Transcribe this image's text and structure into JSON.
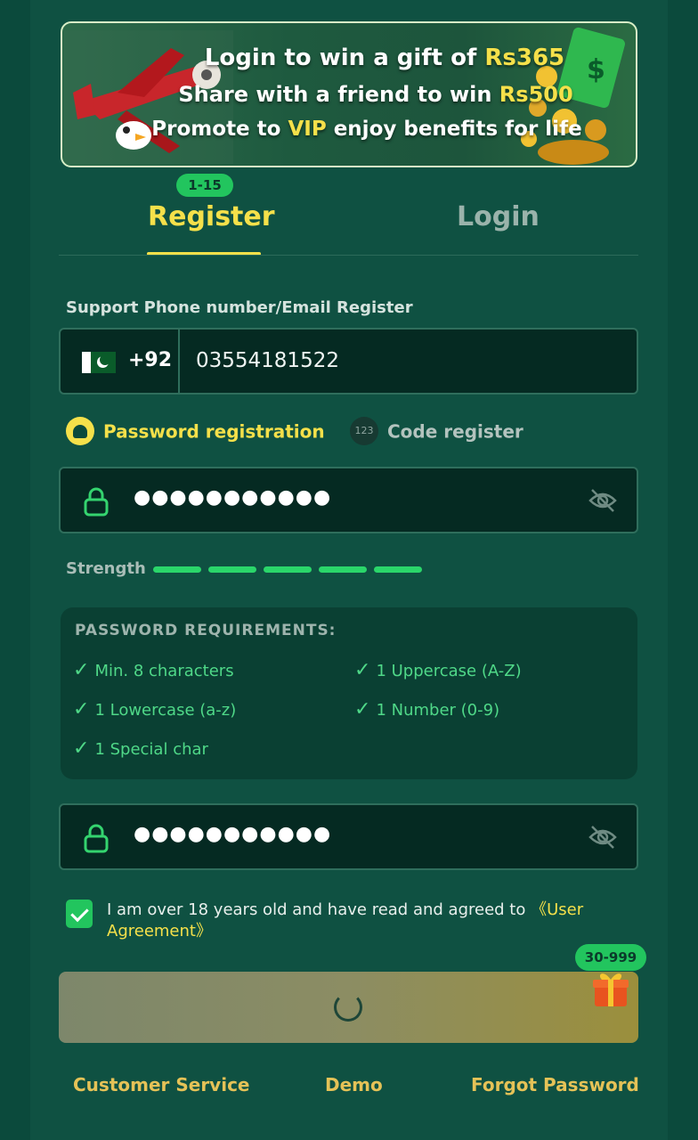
{
  "banner": {
    "line1_pre": "Login to win a gift of ",
    "line1_hl": "Rs365",
    "line2_pre": "Share with a friend to win ",
    "line2_hl": "Rs500",
    "line3_pre": "Promote to ",
    "line3_hl": "VIP",
    "line3_post": " enjoy benefits for life"
  },
  "tabs": {
    "register_badge": "1-15",
    "register": "Register",
    "login": "Login"
  },
  "phone": {
    "label": "Support Phone number/Email Register",
    "country_code": "+92",
    "value": "03554181522"
  },
  "modes": {
    "password": "Password registration",
    "code_icon": "123",
    "code": "Code register"
  },
  "password": {
    "masked": "●●●●●●●●●●●",
    "confirm_masked": "●●●●●●●●●●●"
  },
  "strength": {
    "label": "Strength",
    "level": 5,
    "max": 5
  },
  "requirements": {
    "title": "PASSWORD REQUIREMENTS:",
    "check": "✓",
    "min_chars": "Min. 8 characters",
    "uppercase": "1 Uppercase (A-Z)",
    "lowercase": "1 Lowercase (a-z)",
    "number": "1 Number (0-9)",
    "special": "1 Special char"
  },
  "agreement": {
    "text": "I am over 18 years old and have read and agreed to ",
    "link": "《User Agreement》",
    "checked": true
  },
  "submit": {
    "bonus_badge": "30-999"
  },
  "footer": {
    "customer_service": "Customer Service",
    "demo": "Demo",
    "forgot_password": "Forgot Password"
  },
  "colors": {
    "accent_yellow": "#f5e04a",
    "accent_green": "#22c55e",
    "background": "#0b4a3c"
  }
}
